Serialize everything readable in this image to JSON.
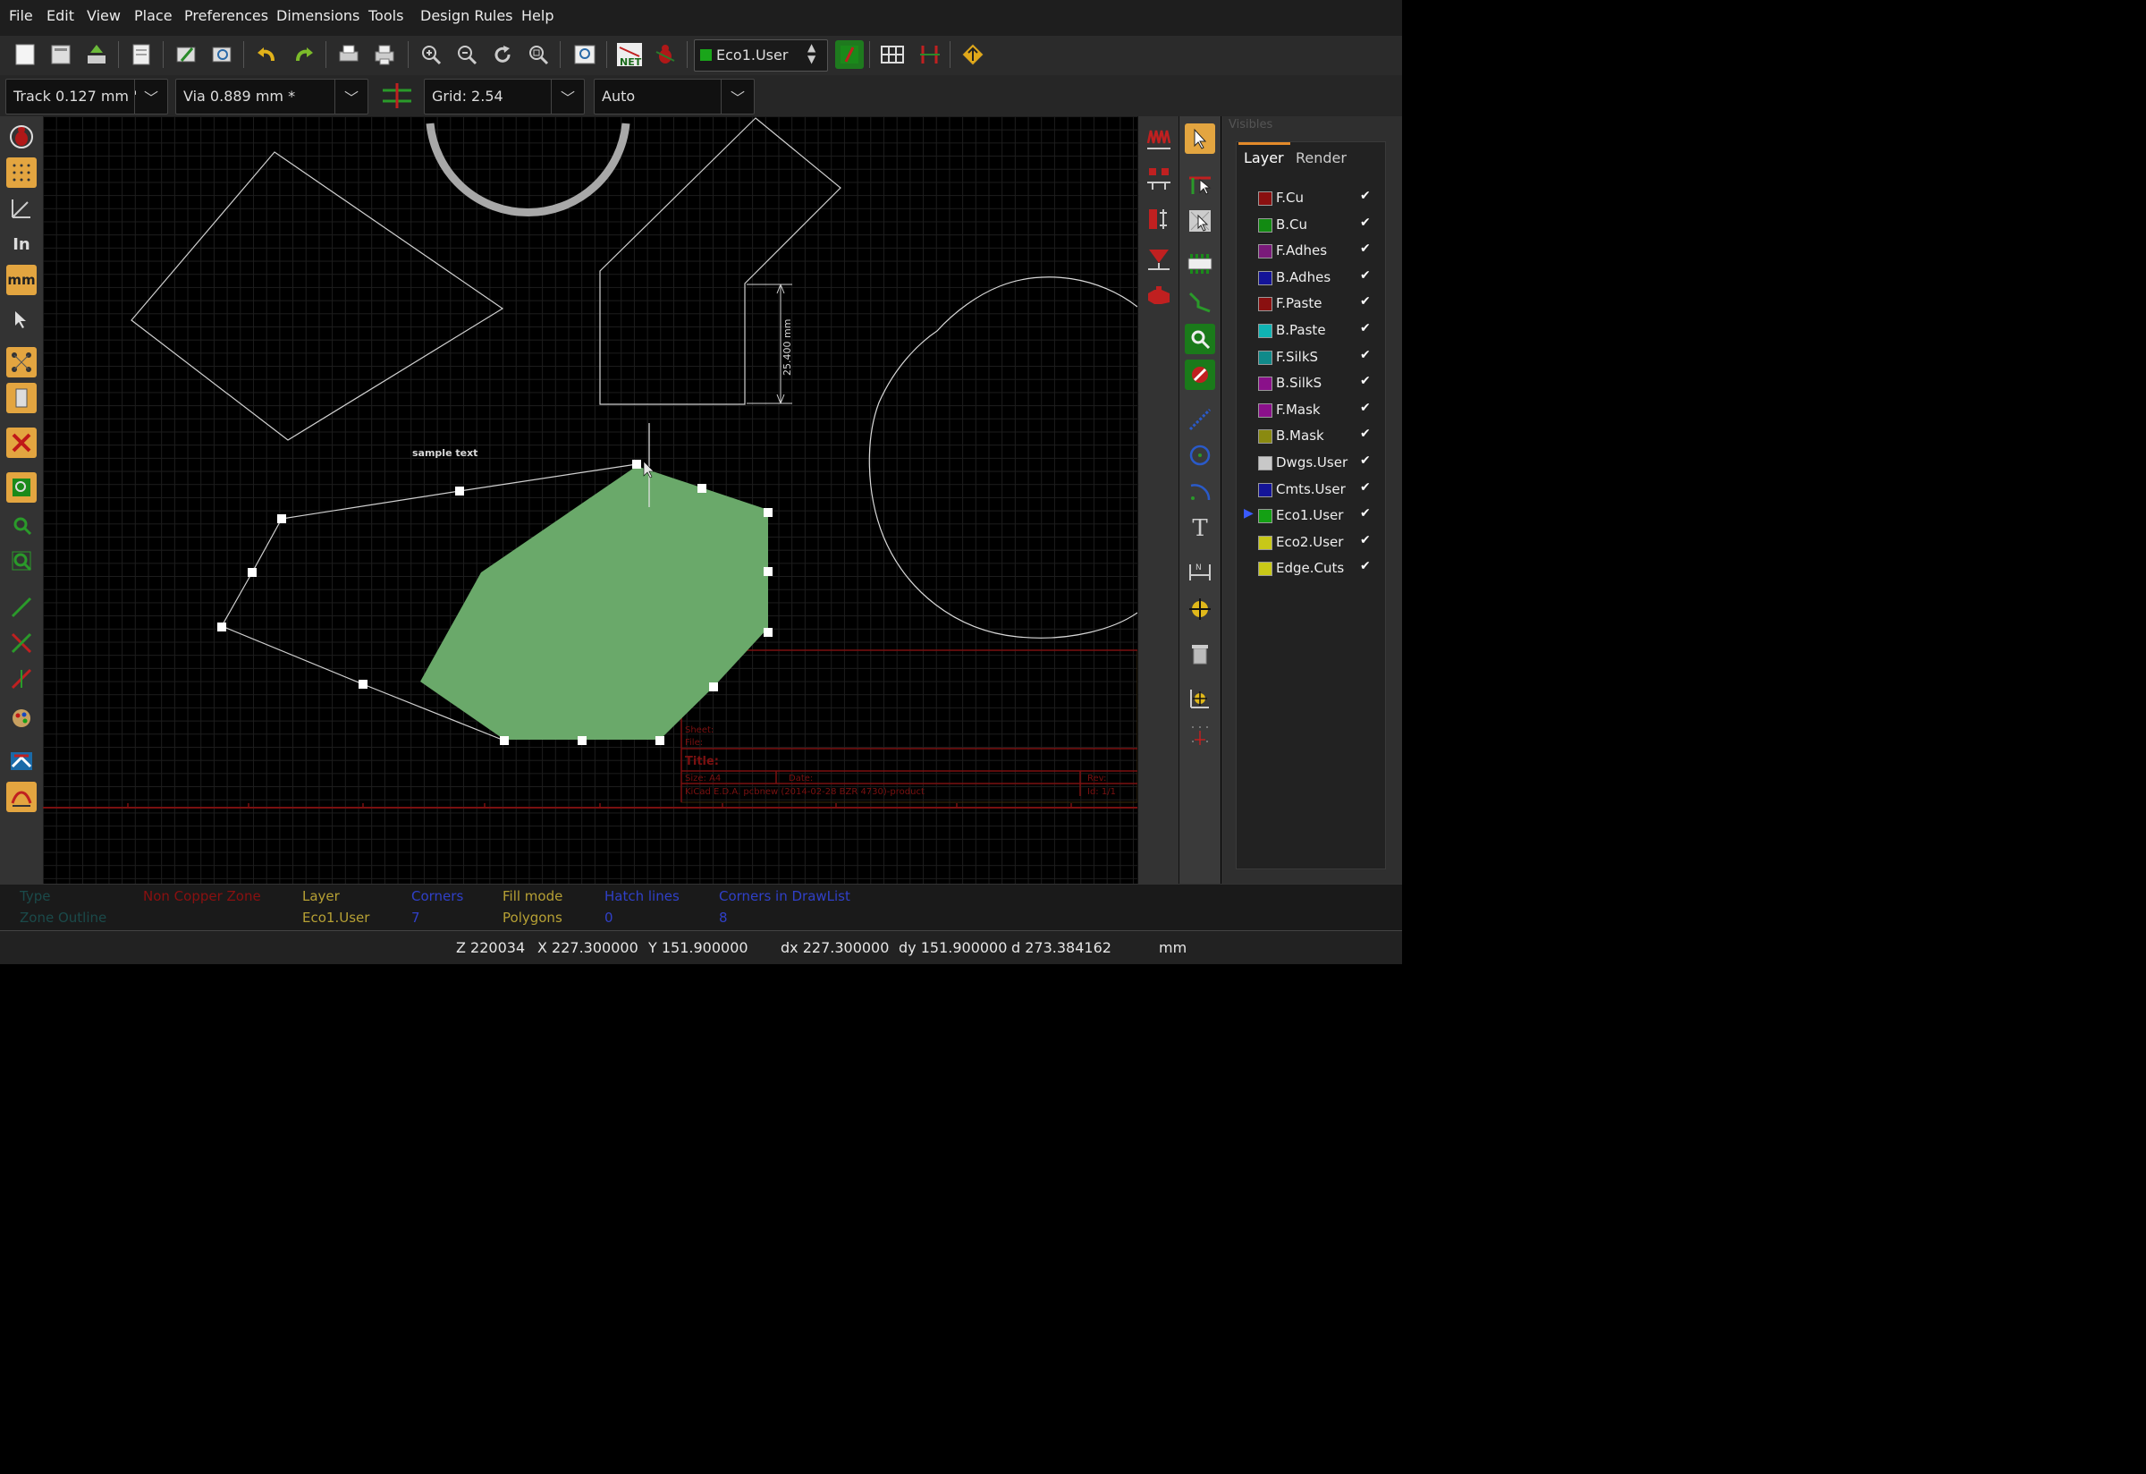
{
  "menu": [
    "File",
    "Edit",
    "View",
    "Place",
    "Preferences",
    "Dimensions",
    "Tools",
    "Design Rules",
    "Help"
  ],
  "toolbar": {
    "active_layer": "Eco1.User",
    "active_layer_color": "#1aa51a",
    "icons": [
      "new-board-icon",
      "open-board-icon",
      "save-board-icon",
      "page-settings-icon",
      "library-editor-icon",
      "library-browser-icon",
      "undo-icon",
      "redo-icon",
      "print-icon",
      "plot-icon",
      "zoom-in-icon",
      "zoom-out-icon",
      "redraw-icon",
      "zoom-fit-icon",
      "find-icon",
      "netlist-icon",
      "drc-icon",
      "layer-pair-icon",
      "autorouter-grid-icon",
      "microwave-icon",
      "script-icon"
    ]
  },
  "auxbar": {
    "track": "Track 0.127 mm '",
    "via": "Via 0.889 mm *",
    "grid": "Grid: 2.54",
    "zoom": "Auto"
  },
  "left_tools": [
    "drc-off-icon",
    "grid-toggle-icon",
    "polar-coords-icon",
    "inch-units-icon",
    "mm-units-icon",
    "cursor-shape-icon",
    "ratsnest-icon",
    "module-ratsnest-icon",
    "auto-delete-icon",
    "zone-fill-icon",
    "zone-outline-icon",
    "zone-sketch-icon",
    "track-sketch-icon",
    "via-sketch-icon",
    "pad-sketch-icon",
    "high-contrast-icon",
    "layer-manager-icon",
    "microwave-toolbar-icon"
  ],
  "right_tools_1": [
    "high-light-net-icon",
    "module-mode-icon",
    "track-mode-icon",
    "local-ratsnest-icon",
    "microwave-tools-icon"
  ],
  "right_tools_2": [
    "select-icon",
    "highlight-net-tool-icon",
    "local-ratsnest-tool-icon",
    "add-module-icon",
    "add-track-icon",
    "add-zone-icon",
    "add-keepout-icon",
    "add-line-icon",
    "add-circle-icon",
    "add-arc-icon",
    "add-text-icon",
    "add-dimension-icon",
    "add-target-icon",
    "delete-icon",
    "set-origin-icon",
    "grid-origin-icon"
  ],
  "canvas": {
    "sample_text": "sample text",
    "dimension_text": "25.400 mm",
    "zone_fill_color": "#6aa96a",
    "titleblock": {
      "sheet": "Sheet:",
      "file": "File:",
      "title": "Title:",
      "size": "Size: A4",
      "date": "Date:",
      "rev": "Rev:",
      "kicad": "KiCad E.D.A.  pcbnew (2014-02-28 BZR 4730)-product",
      "id": "Id: 1/1"
    }
  },
  "visibles": {
    "title": "Visibles",
    "tabs": [
      "Layer",
      "Render"
    ],
    "layers": [
      {
        "name": "F.Cu",
        "color": "#8a1010",
        "checked": "✔"
      },
      {
        "name": "B.Cu",
        "color": "#128a12",
        "checked": "✔"
      },
      {
        "name": "F.Adhes",
        "color": "#7a1a7a",
        "checked": "✔"
      },
      {
        "name": "B.Adhes",
        "color": "#141498",
        "checked": "✔"
      },
      {
        "name": "F.Paste",
        "color": "#8a1010",
        "checked": "✔"
      },
      {
        "name": "B.Paste",
        "color": "#10b4b4",
        "checked": "✔"
      },
      {
        "name": "F.SilkS",
        "color": "#108a8a",
        "checked": "✔"
      },
      {
        "name": "B.SilkS",
        "color": "#8a108a",
        "checked": "✔"
      },
      {
        "name": "F.Mask",
        "color": "#8a108a",
        "checked": "✔"
      },
      {
        "name": "B.Mask",
        "color": "#8a8a10",
        "checked": "✔"
      },
      {
        "name": "Dwgs.User",
        "color": "#c8c8c8",
        "checked": "✔"
      },
      {
        "name": "Cmts.User",
        "color": "#141498",
        "checked": "✔"
      },
      {
        "name": "Eco1.User",
        "color": "#14a014",
        "checked": "✔",
        "active": true
      },
      {
        "name": "Eco2.User",
        "color": "#c8c818",
        "checked": "✔"
      },
      {
        "name": "Edge.Cuts",
        "color": "#c8c818",
        "checked": "✔"
      }
    ]
  },
  "msgpanel": {
    "type_label": "Type",
    "type_value": "Zone Outline",
    "zone_kind": "Non Copper Zone",
    "cols": [
      {
        "h": "Layer",
        "v": "Eco1.User",
        "color": "#b6a034"
      },
      {
        "h": "Corners",
        "v": "7",
        "color": "#3040c8"
      },
      {
        "h": "Fill mode",
        "v": "Polygons",
        "color": "#b6a034"
      },
      {
        "h": "Hatch lines",
        "v": "0",
        "color": "#3040c8"
      },
      {
        "h": "Corners in DrawList",
        "v": "8",
        "color": "#3040c8"
      }
    ]
  },
  "status": {
    "z": "Z 220034",
    "x": "X 227.300000",
    "y": "Y 151.900000",
    "dx": "dx 227.300000",
    "dy": "dy 151.900000",
    "d": "d 273.384162",
    "units": "mm"
  }
}
